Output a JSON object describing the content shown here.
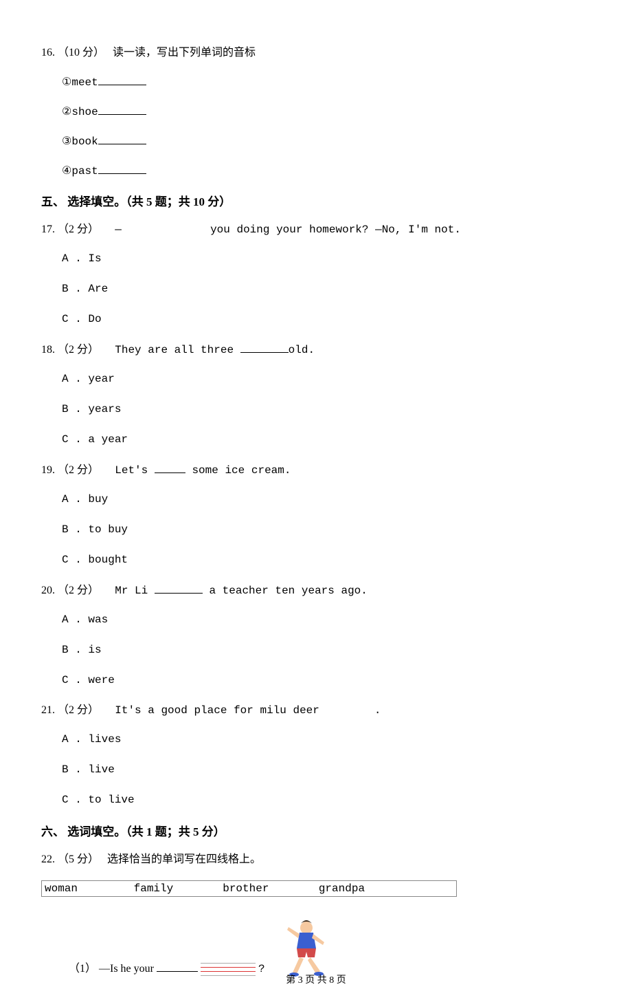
{
  "q16": {
    "number": "16.",
    "points": "（10 分）",
    "prompt": "读一读，写出下列单词的音标",
    "items": [
      {
        "num": "①",
        "word": "meet"
      },
      {
        "num": "②",
        "word": "shoe"
      },
      {
        "num": "③",
        "word": "book"
      },
      {
        "num": "④",
        "word": "past"
      }
    ]
  },
  "section5": {
    "heading": "五、 选择填空。（共 5 题；共 10 分）"
  },
  "q17": {
    "number": "17.",
    "points": "（2 分）",
    "stem_prefix": "—",
    "stem_suffix": "you doing your homework? —No, I'm not.",
    "options": [
      {
        "label": "A .",
        "text": "Is"
      },
      {
        "label": "B .",
        "text": "Are"
      },
      {
        "label": "C .",
        "text": "Do"
      }
    ]
  },
  "q18": {
    "number": "18.",
    "points": "（2 分）",
    "stem_prefix": "They are all three ",
    "stem_suffix": "old.",
    "options": [
      {
        "label": "A .",
        "text": "year"
      },
      {
        "label": "B .",
        "text": "years"
      },
      {
        "label": "C .",
        "text": "a year"
      }
    ]
  },
  "q19": {
    "number": "19.",
    "points": "（2 分）",
    "stem_prefix": "Let's ",
    "stem_suffix": " some ice cream.",
    "options": [
      {
        "label": "A .",
        "text": "buy"
      },
      {
        "label": "B .",
        "text": "to buy"
      },
      {
        "label": "C .",
        "text": "bought"
      }
    ]
  },
  "q20": {
    "number": "20.",
    "points": "（2 分）",
    "stem_prefix": "Mr Li ",
    "stem_suffix": " a teacher ten years ago.",
    "options": [
      {
        "label": "A .",
        "text": "was"
      },
      {
        "label": "B .",
        "text": "is"
      },
      {
        "label": "C .",
        "text": "were"
      }
    ]
  },
  "q21": {
    "number": "21.",
    "points": "（2 分）",
    "stem_prefix": "It's a good place for milu deer",
    "stem_suffix": ".",
    "options": [
      {
        "label": "A .",
        "text": "lives"
      },
      {
        "label": "B .",
        "text": "live"
      },
      {
        "label": "C .",
        "text": "to live"
      }
    ]
  },
  "section6": {
    "heading": "六、 选词填空。（共 1 题；共 5 分）"
  },
  "q22": {
    "number": "22.",
    "points": "（5 分）",
    "prompt": "选择恰当的单词写在四线格上。",
    "words": [
      "woman",
      "family",
      "brother",
      "grandpa"
    ],
    "sub1_prefix": "（1） —Is he your ",
    "sub1_suffix": "?"
  },
  "footer": {
    "text": "第 3 页 共 8 页"
  }
}
